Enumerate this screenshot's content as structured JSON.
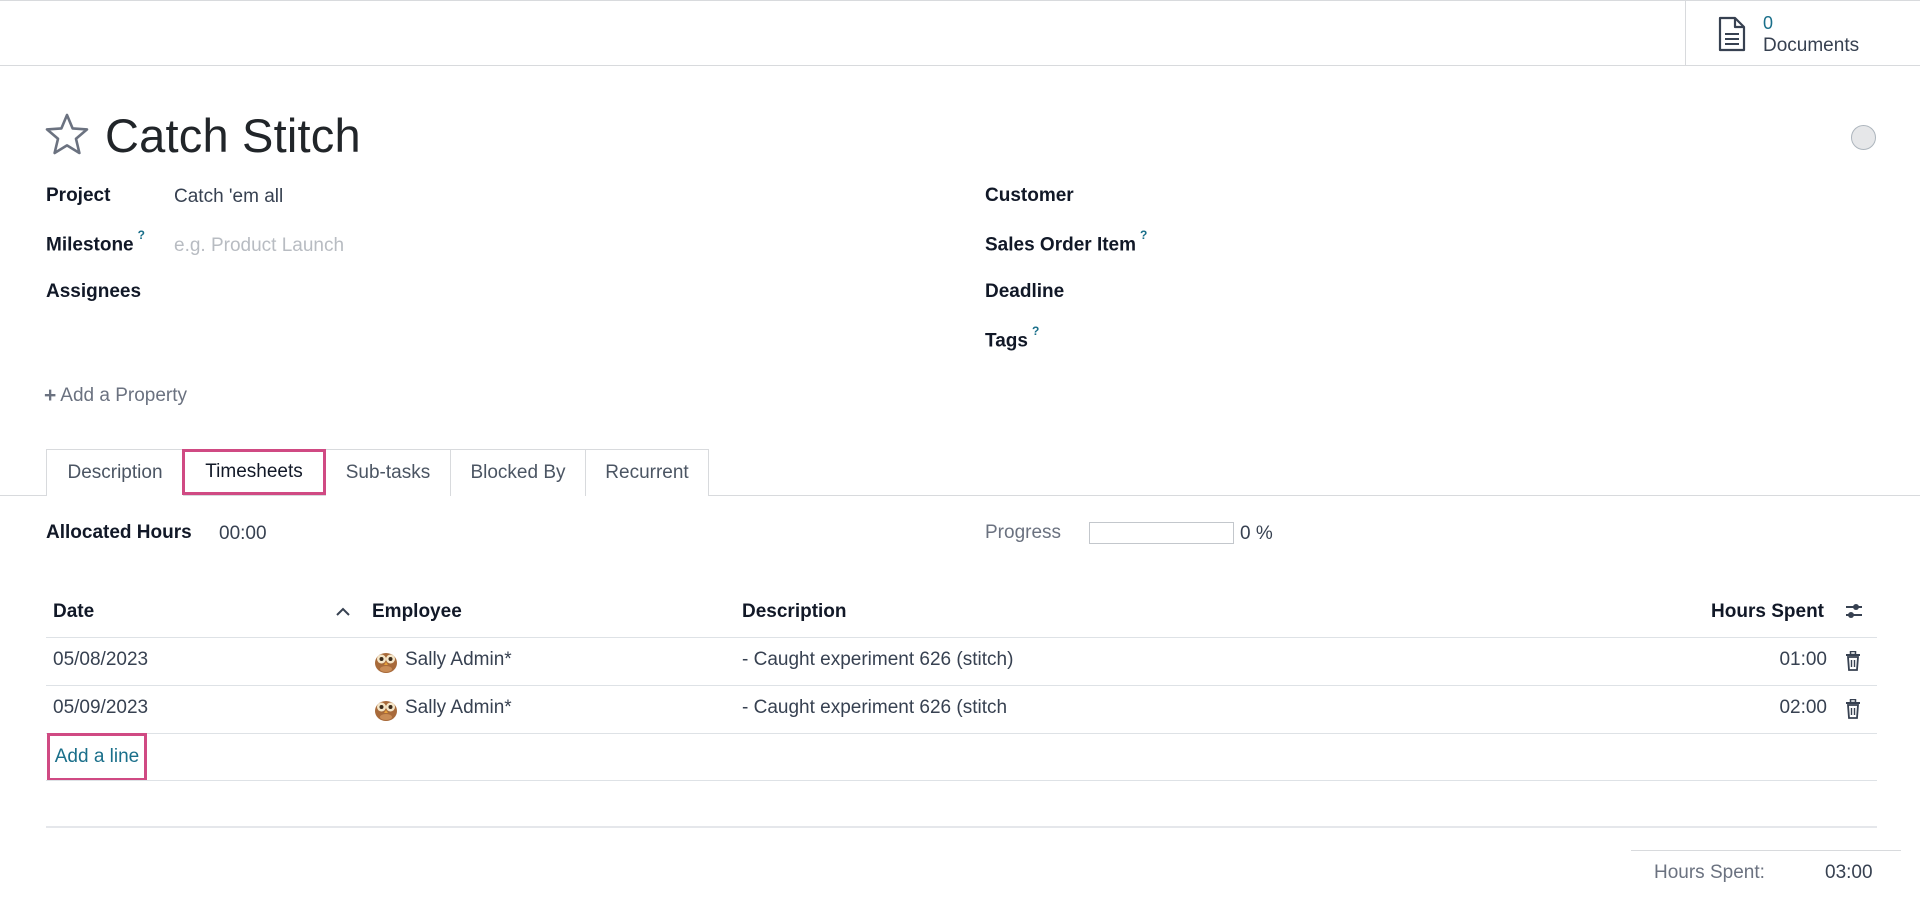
{
  "documents": {
    "count": "0",
    "label": "Documents"
  },
  "task": {
    "title": "Catch Stitch"
  },
  "fields": {
    "project": {
      "label": "Project",
      "value": "Catch 'em all"
    },
    "milestone": {
      "label": "Milestone",
      "help": "?",
      "placeholder": "e.g. Product Launch"
    },
    "assignees": {
      "label": "Assignees"
    },
    "customer": {
      "label": "Customer"
    },
    "sales_order_item": {
      "label": "Sales Order Item",
      "help": "?"
    },
    "deadline": {
      "label": "Deadline"
    },
    "tags": {
      "label": "Tags",
      "help": "?"
    }
  },
  "add_property": {
    "plus": "+",
    "label": "Add a Property"
  },
  "tabs": [
    {
      "label": "Description"
    },
    {
      "label": "Timesheets"
    },
    {
      "label": "Sub-tasks"
    },
    {
      "label": "Blocked By"
    },
    {
      "label": "Recurrent"
    }
  ],
  "active_tab": "Timesheets",
  "timesheet": {
    "allocated_label": "Allocated Hours",
    "allocated_value": "00:00",
    "progress_label": "Progress",
    "progress_text": "0 %",
    "progress_fraction": 0,
    "columns": {
      "date": "Date",
      "employee": "Employee",
      "description": "Description",
      "hours": "Hours Spent"
    },
    "rows": [
      {
        "date": "05/08/2023",
        "employee": "Sally Admin*",
        "description": "- Caught experiment 626 (stitch)",
        "hours": "01:00"
      },
      {
        "date": "05/09/2023",
        "employee": "Sally Admin*",
        "description": "- Caught experiment 626 (stitch",
        "hours": "02:00"
      }
    ],
    "add_line": "Add a line",
    "total_label": "Hours Spent:",
    "total_value": "03:00"
  },
  "colors": {
    "accent": "#1a6f8a",
    "highlight": "#d04a83"
  }
}
